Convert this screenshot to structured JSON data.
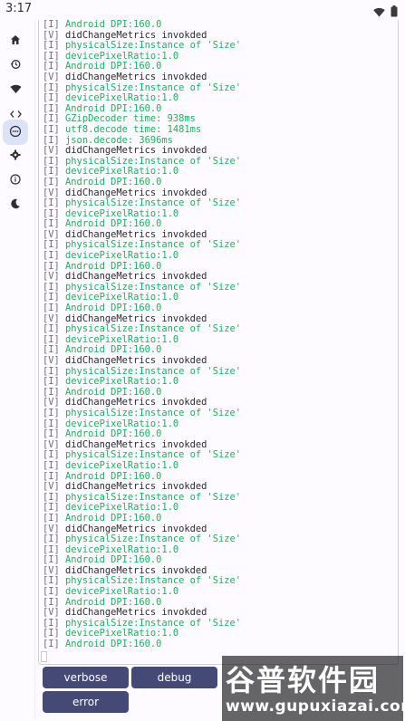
{
  "status": {
    "time": "3:17"
  },
  "rail": {
    "items": [
      {
        "name": "home-icon",
        "active": false
      },
      {
        "name": "history-icon",
        "active": false
      },
      {
        "name": "wifi-icon",
        "active": false
      },
      {
        "name": "code-icon",
        "active": false
      },
      {
        "name": "console-icon",
        "active": true
      },
      {
        "name": "settings-icon",
        "active": false
      },
      {
        "name": "info-icon",
        "active": false
      },
      {
        "name": "dark-mode-icon",
        "active": false
      }
    ]
  },
  "logs": [
    {
      "level": "[I]",
      "text": "Android DPI:160.0"
    },
    {
      "level": "[V]",
      "text": "didChangeMetrics invokded"
    },
    {
      "level": "[I]",
      "text": "physicalSize:Instance of 'Size'"
    },
    {
      "level": "[I]",
      "text": "devicePixelRatio:1.0"
    },
    {
      "level": "[I]",
      "text": "Android DPI:160.0"
    },
    {
      "level": "[V]",
      "text": "didChangeMetrics invokded"
    },
    {
      "level": "[I]",
      "text": "physicalSize:Instance of 'Size'"
    },
    {
      "level": "[I]",
      "text": "devicePixelRatio:1.0"
    },
    {
      "level": "[I]",
      "text": "Android DPI:160.0"
    },
    {
      "level": "[I]",
      "text": "GZipDecoder time: 938ms"
    },
    {
      "level": "[I]",
      "text": "utf8.decode time: 1481ms"
    },
    {
      "level": "[I]",
      "text": "json.decode: 3696ms"
    },
    {
      "level": "[V]",
      "text": "didChangeMetrics invokded"
    },
    {
      "level": "[I]",
      "text": "physicalSize:Instance of 'Size'"
    },
    {
      "level": "[I]",
      "text": "devicePixelRatio:1.0"
    },
    {
      "level": "[I]",
      "text": "Android DPI:160.0"
    },
    {
      "level": "[V]",
      "text": "didChangeMetrics invokded"
    },
    {
      "level": "[I]",
      "text": "physicalSize:Instance of 'Size'"
    },
    {
      "level": "[I]",
      "text": "devicePixelRatio:1.0"
    },
    {
      "level": "[I]",
      "text": "Android DPI:160.0"
    },
    {
      "level": "[V]",
      "text": "didChangeMetrics invokded"
    },
    {
      "level": "[I]",
      "text": "physicalSize:Instance of 'Size'"
    },
    {
      "level": "[I]",
      "text": "devicePixelRatio:1.0"
    },
    {
      "level": "[I]",
      "text": "Android DPI:160.0"
    },
    {
      "level": "[V]",
      "text": "didChangeMetrics invokded"
    },
    {
      "level": "[I]",
      "text": "physicalSize:Instance of 'Size'"
    },
    {
      "level": "[I]",
      "text": "devicePixelRatio:1.0"
    },
    {
      "level": "[I]",
      "text": "Android DPI:160.0"
    },
    {
      "level": "[V]",
      "text": "didChangeMetrics invokded"
    },
    {
      "level": "[I]",
      "text": "physicalSize:Instance of 'Size'"
    },
    {
      "level": "[I]",
      "text": "devicePixelRatio:1.0"
    },
    {
      "level": "[I]",
      "text": "Android DPI:160.0"
    },
    {
      "level": "[V]",
      "text": "didChangeMetrics invokded"
    },
    {
      "level": "[I]",
      "text": "physicalSize:Instance of 'Size'"
    },
    {
      "level": "[I]",
      "text": "devicePixelRatio:1.0"
    },
    {
      "level": "[I]",
      "text": "Android DPI:160.0"
    },
    {
      "level": "[V]",
      "text": "didChangeMetrics invokded"
    },
    {
      "level": "[I]",
      "text": "physicalSize:Instance of 'Size'"
    },
    {
      "level": "[I]",
      "text": "devicePixelRatio:1.0"
    },
    {
      "level": "[I]",
      "text": "Android DPI:160.0"
    },
    {
      "level": "[V]",
      "text": "didChangeMetrics invokded"
    },
    {
      "level": "[I]",
      "text": "physicalSize:Instance of 'Size'"
    },
    {
      "level": "[I]",
      "text": "devicePixelRatio:1.0"
    },
    {
      "level": "[I]",
      "text": "Android DPI:160.0"
    },
    {
      "level": "[V]",
      "text": "didChangeMetrics invokded"
    },
    {
      "level": "[I]",
      "text": "physicalSize:Instance of 'Size'"
    },
    {
      "level": "[I]",
      "text": "devicePixelRatio:1.0"
    },
    {
      "level": "[I]",
      "text": "Android DPI:160.0"
    },
    {
      "level": "[V]",
      "text": "didChangeMetrics invokded"
    },
    {
      "level": "[I]",
      "text": "physicalSize:Instance of 'Size'"
    },
    {
      "level": "[I]",
      "text": "devicePixelRatio:1.0"
    },
    {
      "level": "[I]",
      "text": "Android DPI:160.0"
    },
    {
      "level": "[V]",
      "text": "didChangeMetrics invokded"
    },
    {
      "level": "[I]",
      "text": "physicalSize:Instance of 'Size'"
    },
    {
      "level": "[I]",
      "text": "devicePixelRatio:1.0"
    },
    {
      "level": "[I]",
      "text": "Android DPI:160.0"
    },
    {
      "level": "[V]",
      "text": "didChangeMetrics invokded"
    },
    {
      "level": "[I]",
      "text": "physicalSize:Instance of 'Size'"
    },
    {
      "level": "[I]",
      "text": "devicePixelRatio:1.0"
    },
    {
      "level": "[I]",
      "text": "Android DPI:160.0"
    }
  ],
  "buttons": {
    "verbose": "verbose",
    "debug": "debug",
    "error": "error"
  },
  "watermark": {
    "title": "谷普软件园",
    "url": "www.gupuxiazai.com"
  },
  "colors": {
    "info_text": "#21b05d",
    "verbose_text": "#2b2b2b",
    "button_bg": "#444a75",
    "rail_active": "#dde3f6"
  }
}
